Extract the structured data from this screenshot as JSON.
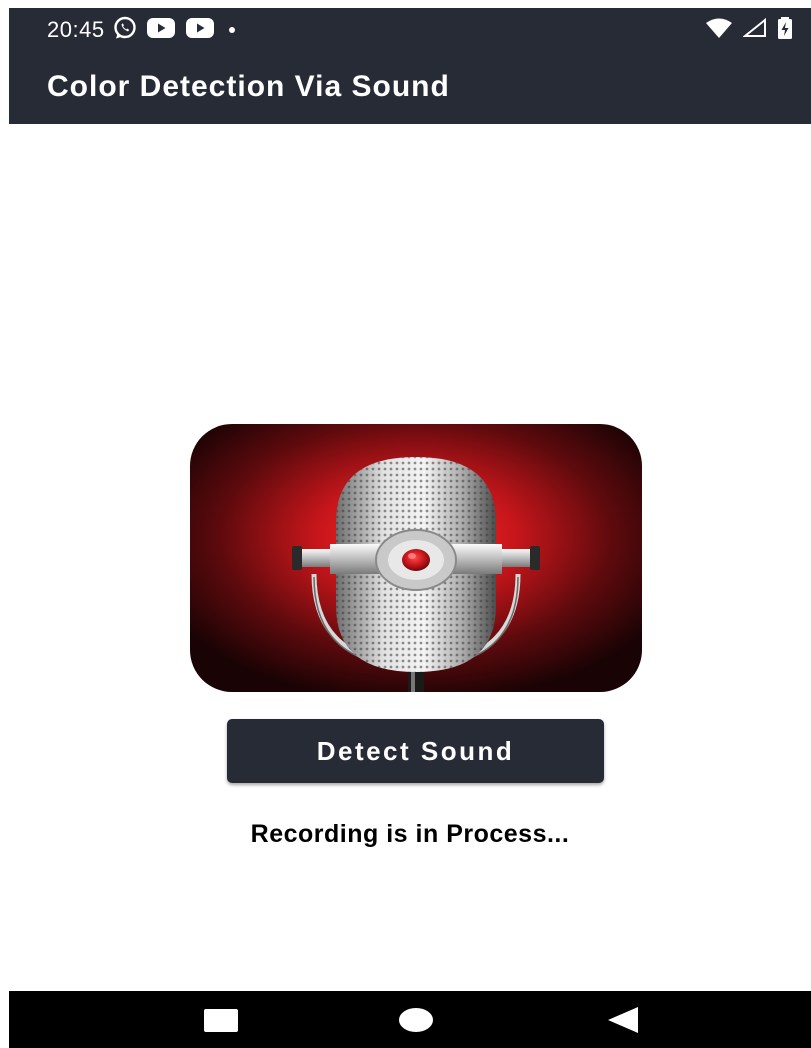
{
  "status_bar": {
    "time": "20:45",
    "left_icons": [
      "whatsapp-icon",
      "youtube-icon",
      "youtube-icon",
      "dot-icon"
    ],
    "right_icons": [
      "wifi-icon",
      "signal-icon",
      "battery-charging-icon"
    ]
  },
  "app_bar": {
    "title": "Color Detection Via Sound"
  },
  "main": {
    "image_icon": "microphone-icon",
    "button_label": "Detect Sound",
    "status_message": "Recording is in Process..."
  },
  "nav_bar": {
    "buttons": [
      "recents-icon",
      "home-icon",
      "back-icon"
    ]
  },
  "colors": {
    "primary_dark": "#262b36",
    "accent_red": "#e01a1a",
    "background": "#ffffff"
  }
}
